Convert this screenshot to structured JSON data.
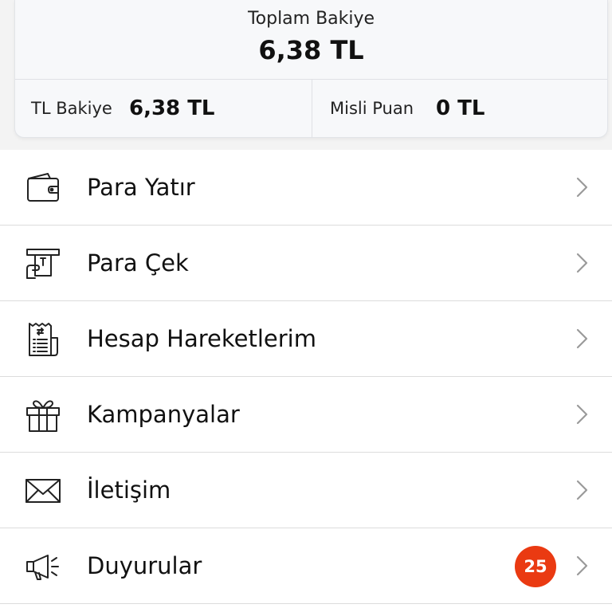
{
  "balance": {
    "total_label": "Toplam Bakiye",
    "total_value": "6,38 TL",
    "tl_label": "TL Bakiye",
    "tl_value": "6,38 TL",
    "points_label": "Misli Puan",
    "points_value": "0 TL"
  },
  "menu": {
    "items": [
      {
        "label": "Para Yatır",
        "icon": "wallet-icon"
      },
      {
        "label": "Para Çek",
        "icon": "atm-withdraw-icon"
      },
      {
        "label": "Hesap Hareketlerim",
        "icon": "receipt-icon"
      },
      {
        "label": "Kampanyalar",
        "icon": "gift-icon"
      },
      {
        "label": "İletişim",
        "icon": "envelope-icon"
      },
      {
        "label": "Duyurular",
        "icon": "megaphone-icon",
        "badge": "25"
      }
    ]
  },
  "colors": {
    "badge": "#ea3a12",
    "chevron": "#9a9a9a"
  }
}
